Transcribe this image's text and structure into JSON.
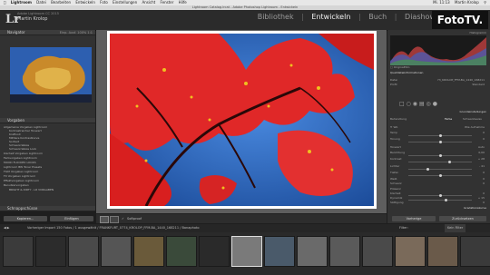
{
  "os_menu": {
    "items": [
      "Lightroom",
      "Datei",
      "Bearbeiten",
      "Entwickeln",
      "Foto",
      "Einstellungen",
      "Ansicht",
      "Fenster",
      "Hilfe"
    ],
    "clock": "Mi. 11:13",
    "user": "Martin Krolop"
  },
  "window": {
    "title": "Lightroom Catalog.lrcat - Adobe Photoshop Lightroom - Entwickeln"
  },
  "identity": {
    "logo": "Lr",
    "version": "Adobe Lightroom CC 2015",
    "user": "Martin Krolop"
  },
  "modules": [
    "Bibliothek",
    "Entwickeln",
    "Buch",
    "Diashow"
  ],
  "active_module": "Entwickeln",
  "brand": {
    "label": "FotoTV."
  },
  "left_panel": {
    "navigator": {
      "title": "Navigator",
      "options": "Einp.  Ausf.  100%  1:1"
    },
    "presets": {
      "title": "Vorgaben",
      "items": [
        "Allgemeine Vorgaben Lightroom",
        "Kontrastreicher Tonwert",
        "Kraftvoll",
        "Mittlere Kontrastkurve",
        "Sortiert",
        "Schwarz-Weiss",
        "Schwarz-Weiss Look",
        "Klarheit Vorgaben Lightroom",
        "Farbvorgaben Lightroom",
        "MOOD FLOCKED LOOKS",
        "Lightroom BW Toner Presets",
        "FILM Vorgaben Lightroom",
        "FX Vorgaben Lightroom",
        "Effektvorgaben Lightroom",
        "Benutzervorgaben",
        "BRIGHT & DIRTY - LR VORGABEN"
      ],
      "bottom": "Schnappschüsse"
    },
    "copy_button": "Kopieren...",
    "paste_button": "Einfügen"
  },
  "toolbar": {
    "softproof_label": "Softproof"
  },
  "right_panel": {
    "histogram_title": "Histogramm",
    "original_label": "Originalfoto",
    "info_title": "Quelldateiinformationen",
    "info_rows": [
      {
        "label": "Datei",
        "value": "73_KROLOP_FFM-BA_1440_168211"
      },
      {
        "label": "Profil",
        "value": "Standard"
      }
    ],
    "section_basic": "Grundeinstellungen",
    "treatment": {
      "label": "Behandlung",
      "color": "Farbe",
      "bw": "Schwarzweiss"
    },
    "wb": {
      "label": "WA",
      "value": "Wie Aufnahme"
    },
    "rows": [
      {
        "label": "Temp",
        "value": "0"
      },
      {
        "label": "Tonung",
        "value": "0"
      },
      {
        "label": "Tonwert",
        "value": "Auto"
      },
      {
        "label": "Belichtung",
        "value": "0,00"
      },
      {
        "label": "Kontrast",
        "value": "+ 28"
      },
      {
        "label": "Lichter",
        "value": "- 41"
      },
      {
        "label": "Tiefen",
        "value": "0"
      },
      {
        "label": "Weiß",
        "value": "0"
      },
      {
        "label": "Schwarz",
        "value": "0"
      },
      {
        "label": "Präsenz",
        "value": ""
      },
      {
        "label": "Klarheit",
        "value": "0"
      },
      {
        "label": "Dynamik",
        "value": "+ 15"
      },
      {
        "label": "Sättigung",
        "value": "0"
      }
    ],
    "gradation": "Gradationskurve",
    "prev_button": "Vorherige",
    "reset_button": "Zurücksetzen"
  },
  "filmstrip": {
    "label": "Vorheriger Import   150 Fotos / 1 ausgewählt / FRANKFURT_0774_KROLOP_FFM-BA_1440_168211 / Banaphoto",
    "filter_label": "Filter:",
    "filter_value": "Kein Filter",
    "selected_index": 7,
    "frame_count": 15
  },
  "colors": {
    "accent": "#e03030",
    "sky": "#2e64b8"
  }
}
